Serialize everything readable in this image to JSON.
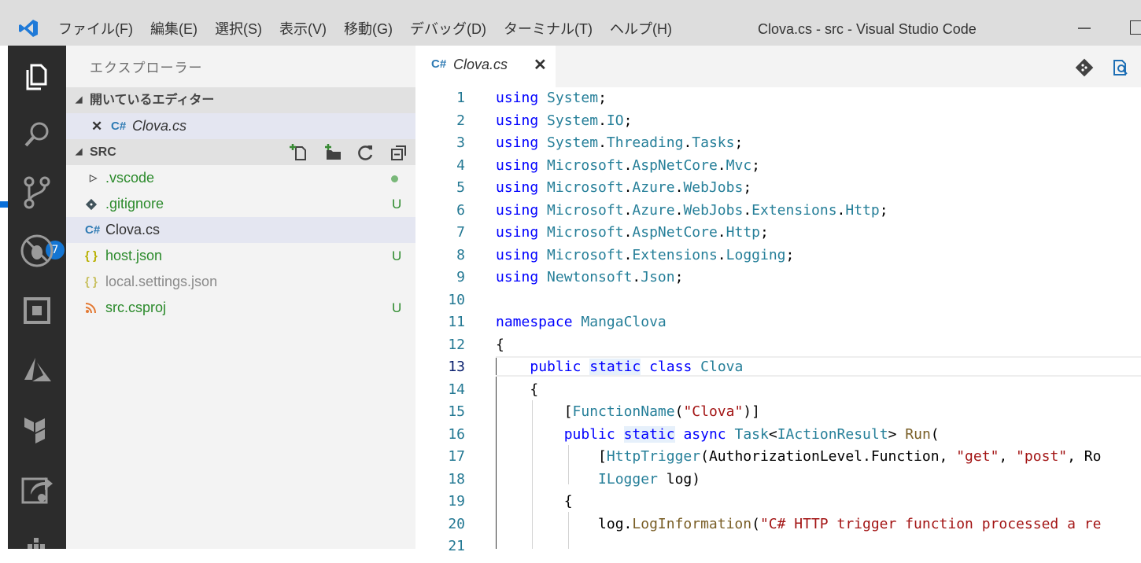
{
  "window": {
    "title": "Clova.cs - src - Visual Studio Code",
    "menu": [
      "ファイル(F)",
      "編集(E)",
      "選択(S)",
      "表示(V)",
      "移動(G)",
      "デバッグ(D)",
      "ターミナル(T)",
      "ヘルプ(H)"
    ]
  },
  "activity_bar": {
    "items": [
      "explorer-icon",
      "search-icon",
      "source-control-icon",
      "debug-icon",
      "extensions-icon",
      "azure-icon",
      "terraform-icon",
      "remote-icon",
      "docker-icon"
    ],
    "scm_badge": "7"
  },
  "sidebar": {
    "title": "エクスプローラー",
    "open_editors_label": "開いているエディター",
    "open_editors": [
      {
        "name": "Clova.cs",
        "icon": "C#"
      }
    ],
    "folder_label": "SRC",
    "files": [
      {
        "name": ".vscode",
        "icon": "folder-chevron",
        "status": "",
        "modified_dot": true
      },
      {
        "name": ".gitignore",
        "icon": "git-icon",
        "status": "U"
      },
      {
        "name": "Clova.cs",
        "icon": "C#",
        "status": ""
      },
      {
        "name": "host.json",
        "icon": "{ }",
        "status": "U"
      },
      {
        "name": "local.settings.json",
        "icon": "{ }",
        "status": ""
      },
      {
        "name": "src.csproj",
        "icon": "rss-icon",
        "status": "U"
      }
    ]
  },
  "editor": {
    "tab_label": "Clova.cs",
    "tab_icon": "C#",
    "current_line": 13,
    "line_numbers": [
      "1",
      "2",
      "3",
      "4",
      "5",
      "6",
      "7",
      "8",
      "9",
      "10",
      "11",
      "12",
      "13",
      "14",
      "15",
      "16",
      "17",
      "18",
      "19",
      "20",
      "21"
    ]
  },
  "colors": {
    "keyword": "#0000ff",
    "type": "#267f99",
    "string": "#a31515",
    "line_number": "#237893",
    "untracked": "#2b8a2b",
    "badge": "#1475d2"
  }
}
